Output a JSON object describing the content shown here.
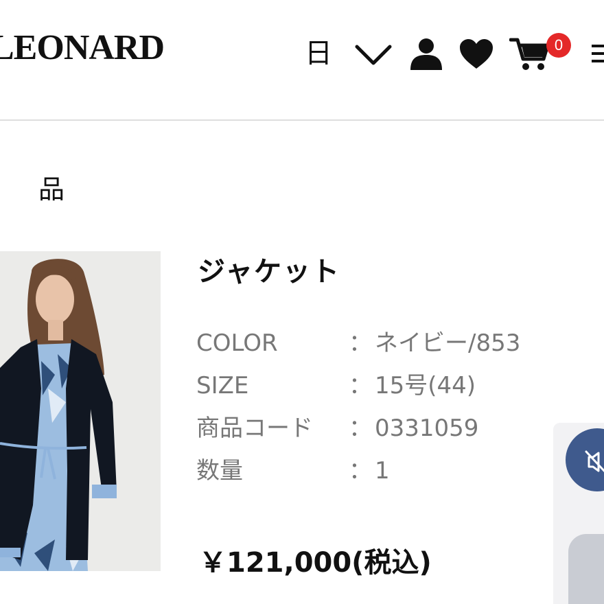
{
  "header": {
    "logo": "LEONARD",
    "language": "日",
    "icons": [
      "chevron-down-icon",
      "user-icon",
      "heart-icon",
      "cart-icon",
      "menu-icon"
    ],
    "cart_count": "0",
    "menu_glyph": "三"
  },
  "page": {
    "section_title": "品"
  },
  "product": {
    "name": "ジャケット",
    "specs": [
      {
        "label": "COLOR",
        "colon": "：",
        "value": "ネイビー/853"
      },
      {
        "label": "SIZE",
        "colon": "：",
        "value": "15号(44)"
      },
      {
        "label": "商品コード",
        "colon": "：",
        "value": "0331059"
      },
      {
        "label": "数量",
        "colon": "：",
        "value": "1"
      }
    ],
    "price": "￥121,000(税込)"
  },
  "colors": {
    "badge": "#e42828",
    "fab": "#3f5a8d",
    "spec_text": "#777777",
    "divider": "#dedede"
  }
}
